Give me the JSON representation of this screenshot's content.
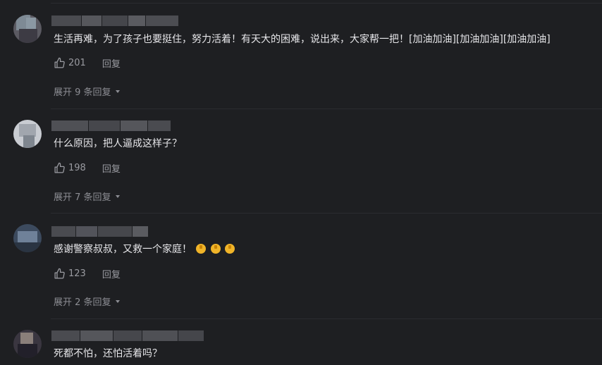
{
  "colors": {
    "background": "#1e1f22",
    "text": "#e6e6e9",
    "muted": "#9a9ba1",
    "divider": "#2b2c30"
  },
  "comments": [
    {
      "text": "生活再难，为了孩子也要挺住，努力活着！有天大的困难，说出来，大家帮一把！[加油加油][加油加油][加油加油]",
      "likes": "201",
      "reply_label": "回复",
      "expand_label": "展开 9 条回复",
      "icon": "thumbs-up-icon"
    },
    {
      "text": "什么原因，把人逼成这样子？",
      "likes": "198",
      "reply_label": "回复",
      "expand_label": "展开 7 条回复",
      "icon": "thumbs-up-icon"
    },
    {
      "text": "感谢警察叔叔，又救一个家庭！",
      "emoji": [
        "thumbs-up-emoji",
        "thumbs-up-emoji",
        "thumbs-up-emoji"
      ],
      "likes": "123",
      "reply_label": "回复",
      "expand_label": "展开 2 条回复",
      "icon": "thumbs-up-icon"
    },
    {
      "text": "死都不怕，还怕活着吗？"
    }
  ]
}
